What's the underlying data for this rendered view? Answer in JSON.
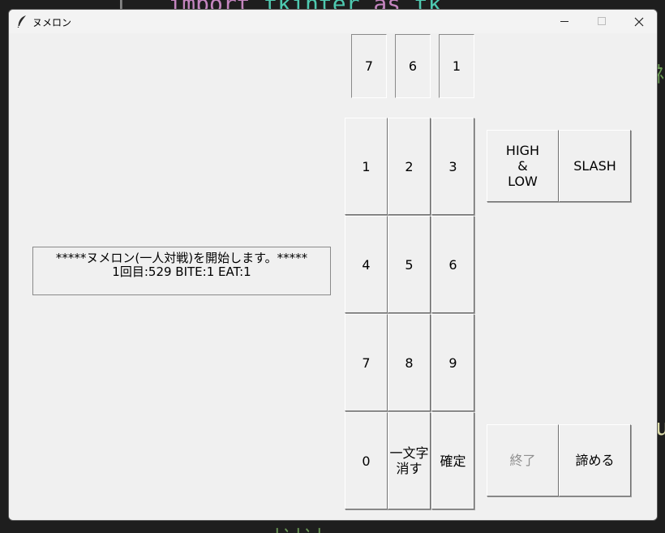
{
  "window": {
    "title": "ヌメロン"
  },
  "slots": [
    "7",
    "6",
    "1"
  ],
  "message": {
    "line1": "*****ヌメロン(一人対戦)を開始します。*****",
    "line2": "1回目:529 BITE:1 EAT:1"
  },
  "keypad": [
    "1",
    "2",
    "3",
    "4",
    "5",
    "6",
    "7",
    "8",
    "9",
    "0",
    "一文字\n消す",
    "確定"
  ],
  "side_buttons": {
    "high_low": "HIGH\n&\nLOW",
    "slash": "SLASH",
    "quit": "終了",
    "give_up": "諦める"
  },
  "colors": {
    "window_bg": "#f0f0f0",
    "editor_bg": "#1e1e1e",
    "disabled_text": "#8f8f8f"
  }
}
